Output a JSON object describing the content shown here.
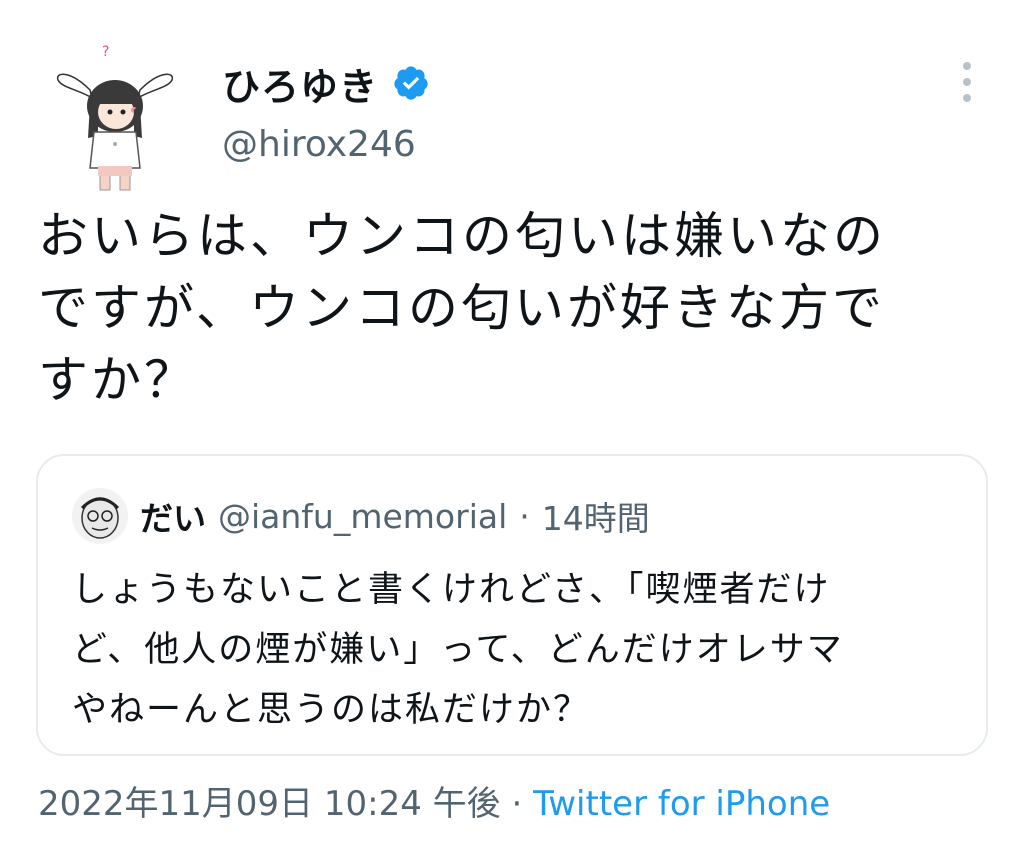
{
  "author": {
    "display_name": "ひろゆき",
    "handle": "@hirox246",
    "avatar_icon": "bunny-ear-character-avatar",
    "verified_icon": "verified-badge-icon"
  },
  "tweet": {
    "lines": [
      "おいらは、ウンコの匂いは嫌いなの",
      "ですが、ウンコの匂いが好きな方で",
      "すか？"
    ]
  },
  "quoted_tweet": {
    "display_name": "だい",
    "handle": "@ianfu_memorial",
    "separator": "·",
    "time": "14時間",
    "lines": [
      "しょうもないこと書くけれどさ、「喫煙者だけ",
      "ど、他人の煙が嫌い」って、どんだけオレサマ",
      "やねーんと思うのは私だけか？"
    ]
  },
  "footer": {
    "timestamp": "2022年11月09日 10:24 午後",
    "separator": "·",
    "source": "Twitter for iPhone"
  },
  "colors": {
    "text": "#0f1419",
    "secondary": "#536471",
    "accent": "#1d9bf0",
    "border": "#e6ecf0"
  }
}
